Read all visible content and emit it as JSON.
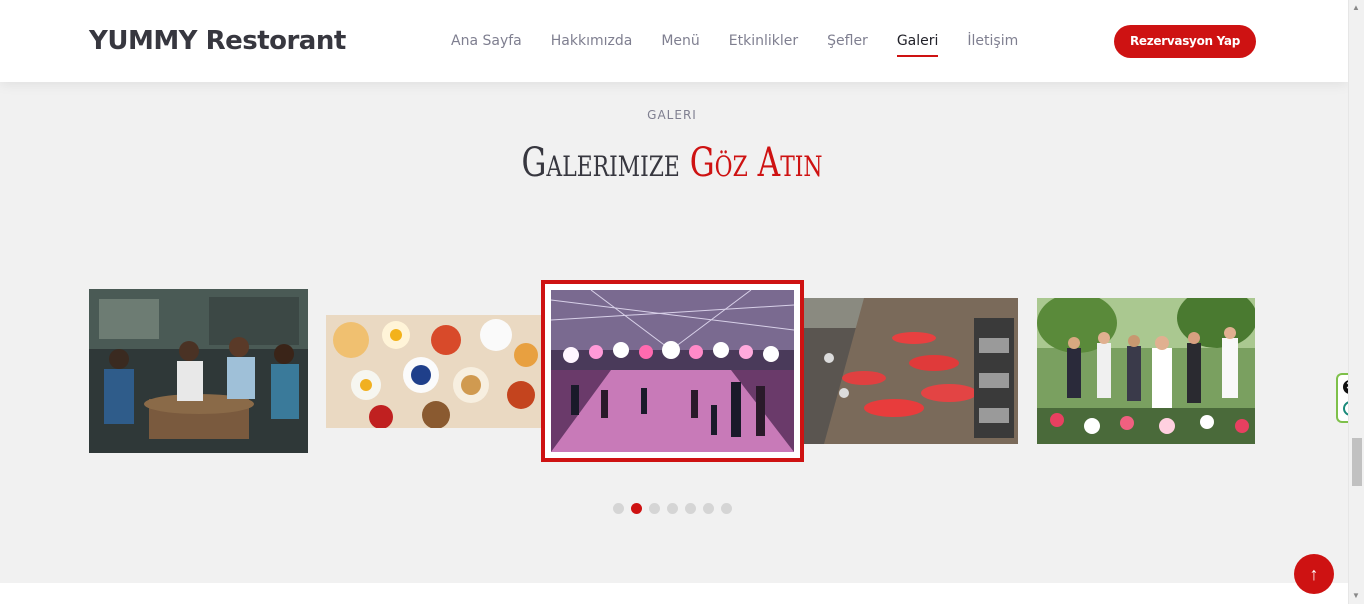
{
  "header": {
    "logo": "YUMMY Restorant",
    "nav": [
      {
        "label": "Ana Sayfa"
      },
      {
        "label": "Hakkımızda"
      },
      {
        "label": "Menü"
      },
      {
        "label": "Etkinlikler"
      },
      {
        "label": "Şefler"
      },
      {
        "label": "Galeri",
        "active": true
      },
      {
        "label": "İletişim"
      }
    ],
    "cta": "Rezervasyon Yap"
  },
  "gallery": {
    "label": "GALERI",
    "title_main": "Galerimize ",
    "title_accent": "Göz Atın",
    "slides": [
      {
        "name": "friends-cafe-photo"
      },
      {
        "name": "brunch-table-photo"
      },
      {
        "name": "night-tent-party-photo",
        "active": true
      },
      {
        "name": "banquet-table-photo"
      },
      {
        "name": "wedding-celebration-photo"
      }
    ],
    "pagination": {
      "count": 7,
      "active_index": 1
    }
  },
  "back_to_top_icon": "arrow-up-icon",
  "colors": {
    "accent": "#ce1212",
    "text_dark": "#37373f",
    "text_muted": "#7f7f90",
    "background": "#f1f1f1"
  },
  "side_widget": {
    "close_icon": "close-icon",
    "e_icon": "e-icon",
    "close_glyph": "✕",
    "e_glyph": "e"
  }
}
